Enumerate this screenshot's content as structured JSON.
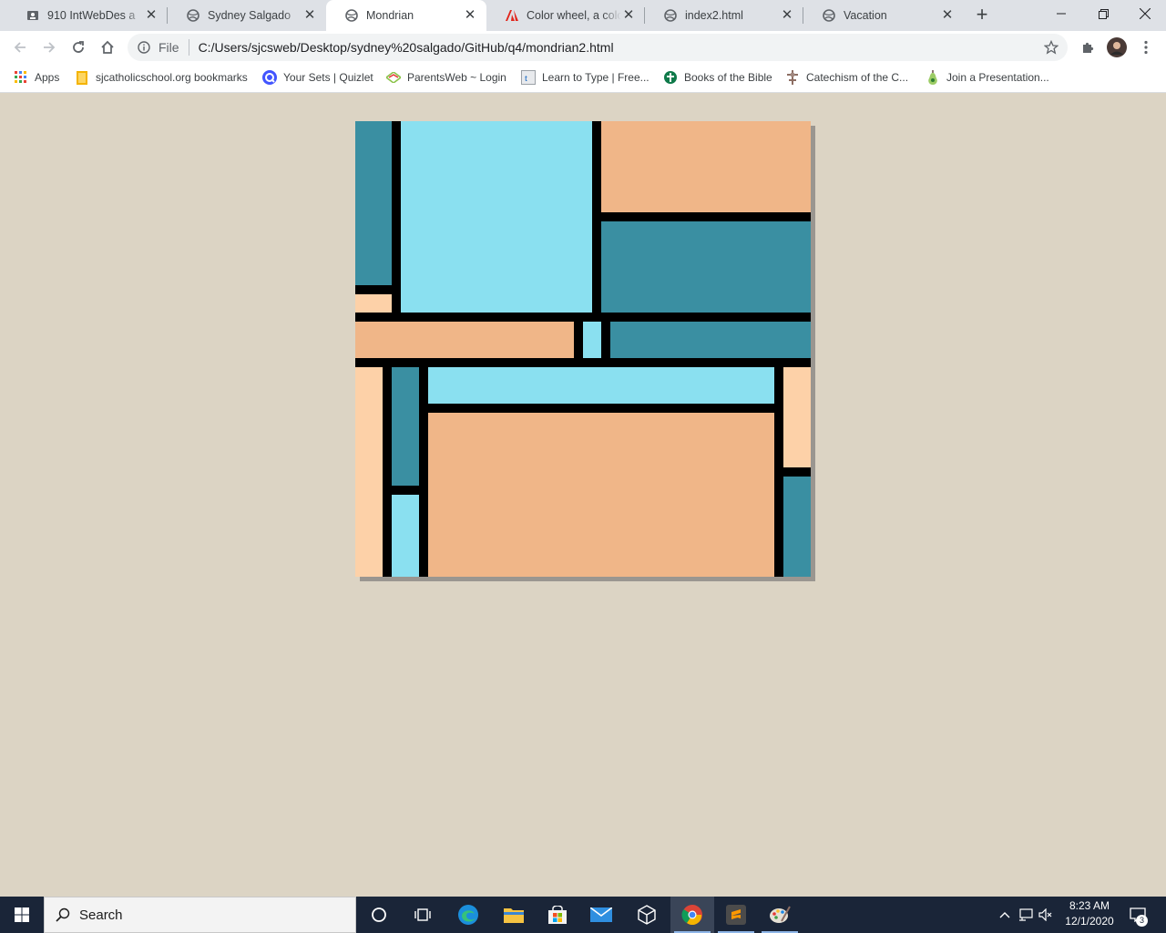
{
  "tabs": [
    {
      "title": "910 IntWebDes a",
      "icon": "classroom-icon",
      "active": false
    },
    {
      "title": "Sydney Salgado",
      "icon": "globe-icon",
      "active": false
    },
    {
      "title": "Mondrian",
      "icon": "globe-icon",
      "active": true
    },
    {
      "title": "Color wheel, a color g",
      "icon": "adobe-icon",
      "active": false
    },
    {
      "title": "index2.html",
      "icon": "globe-icon",
      "active": false
    },
    {
      "title": "Vacation",
      "icon": "globe-icon",
      "active": false
    }
  ],
  "toolbar": {
    "file_label": "File",
    "url": "C:/Users/sjcsweb/Desktop/sydney%20salgado/GitHub/q4/mondrian2.html"
  },
  "bookmarks": [
    {
      "label": "Apps",
      "icon": "apps-grid-icon"
    },
    {
      "label": "sjcatholicschool.org bookmarks",
      "icon": "folder-icon"
    },
    {
      "label": "Your Sets | Quizlet",
      "icon": "quizlet-icon"
    },
    {
      "label": "ParentsWeb ~ Login",
      "icon": "parentsweb-icon"
    },
    {
      "label": "Learn to Type | Free...",
      "icon": "typing-icon"
    },
    {
      "label": "Books of the Bible",
      "icon": "cross-globe-icon"
    },
    {
      "label": "Catechism of the C...",
      "icon": "catechism-icon"
    },
    {
      "label": "Join a Presentation...",
      "icon": "pear-icon"
    }
  ],
  "colors": {
    "page_bg": "#dcd4c4",
    "teal": "#3a8fa2",
    "light_blue": "#8ae0f0",
    "salmon": "#f0b688",
    "peach": "#fdd1a8",
    "grid_line": "#000000"
  },
  "taskbar": {
    "search_label": "Search",
    "time": "8:23 AM",
    "date": "12/1/2020",
    "notifications": "3",
    "apps": [
      "cortana-icon",
      "task-view-icon",
      "edge-icon",
      "file-explorer-icon",
      "store-icon",
      "mail-icon",
      "3d-viewer-icon",
      "chrome-icon",
      "sublime-icon",
      "paint-icon"
    ]
  }
}
